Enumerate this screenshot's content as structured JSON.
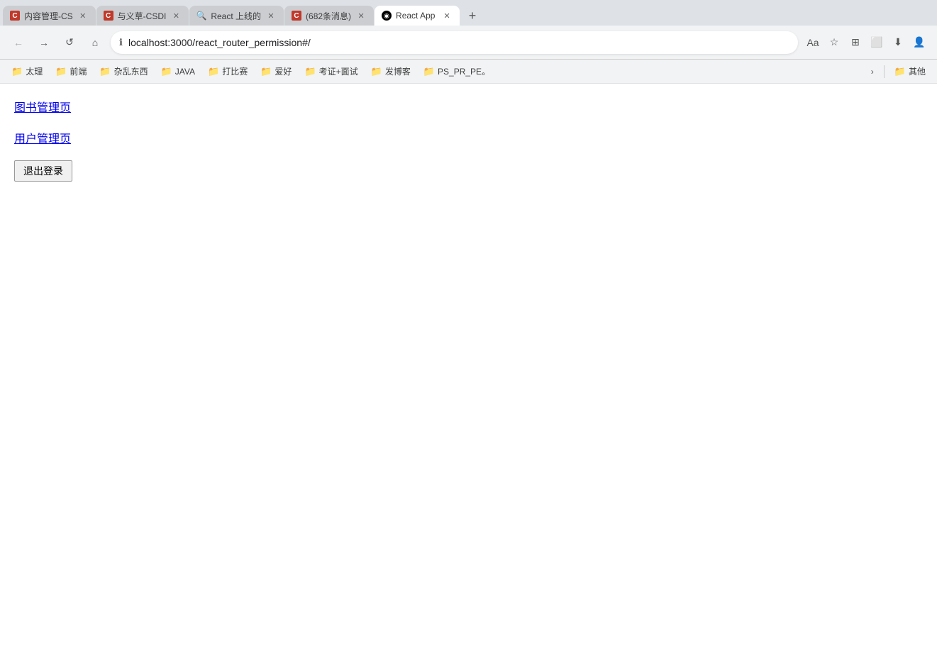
{
  "browser": {
    "tabs": [
      {
        "id": "tab1",
        "label": "内容管理-CS",
        "favicon_type": "red",
        "favicon_text": "C",
        "active": false
      },
      {
        "id": "tab2",
        "label": "与义草-CSDI",
        "favicon_type": "red",
        "favicon_text": "C",
        "active": false
      },
      {
        "id": "tab3",
        "label": "React 上线的",
        "favicon_type": "search",
        "favicon_text": "🔍",
        "active": false
      },
      {
        "id": "tab4",
        "label": "(682条消息)",
        "favicon_type": "red",
        "favicon_text": "C",
        "active": false
      },
      {
        "id": "tab5",
        "label": "React App",
        "favicon_type": "robot",
        "favicon_text": "◉",
        "active": true
      }
    ],
    "url": "localhost:3000/react_router_permission#/",
    "info_icon": "ℹ",
    "new_tab_label": "+",
    "nav": {
      "back": "←",
      "forward": "→",
      "reload": "↺",
      "home": "⌂"
    }
  },
  "bookmarks": [
    {
      "label": "太理",
      "icon": "📁"
    },
    {
      "label": "前端",
      "icon": "📁"
    },
    {
      "label": "杂乱东西",
      "icon": "📁"
    },
    {
      "label": "JAVA",
      "icon": "📁"
    },
    {
      "label": "打比赛",
      "icon": "📁"
    },
    {
      "label": "爱好",
      "icon": "📁"
    },
    {
      "label": "考证+面试",
      "icon": "📁"
    },
    {
      "label": "发博客",
      "icon": "📁"
    },
    {
      "label": "PS_PR_PE。",
      "icon": "📁"
    },
    {
      "label": "其他",
      "icon": "📁"
    }
  ],
  "bookmarks_more_label": "›",
  "page": {
    "links": [
      {
        "label": "图书管理页",
        "href": "#"
      },
      {
        "label": "用户管理页",
        "href": "#"
      }
    ],
    "logout_button_label": "退出登录"
  },
  "address_icons": {
    "read": "Aa",
    "star": "☆",
    "bookmark_list": "⊞",
    "screenshot": "⬜",
    "download": "⬇",
    "profile": "👤"
  }
}
